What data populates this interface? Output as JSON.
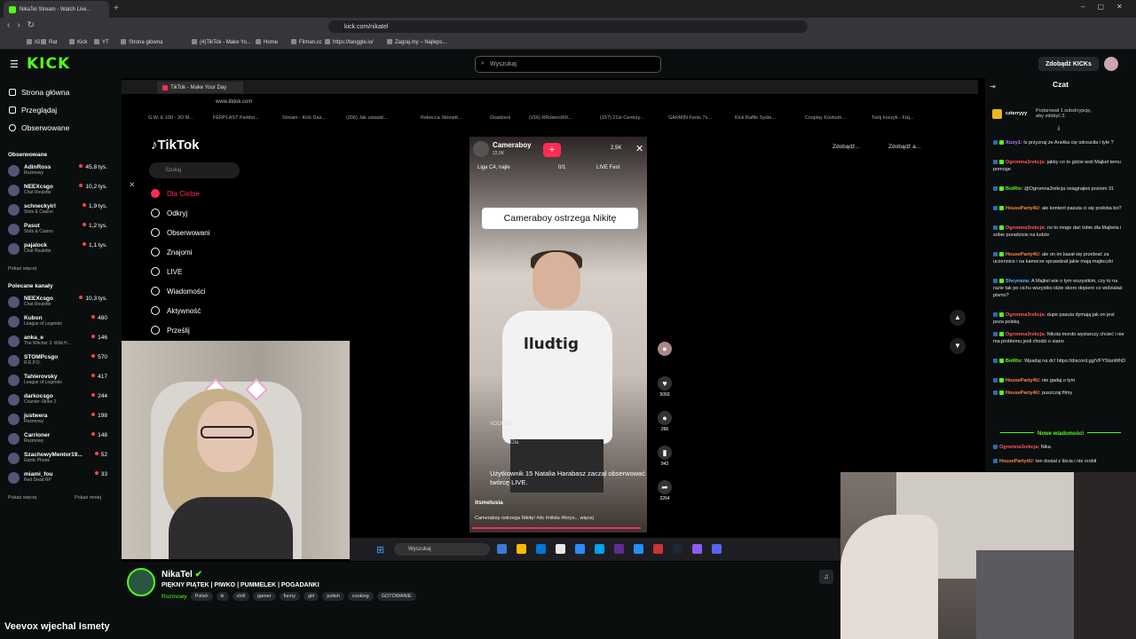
{
  "browser": {
    "tab_title": "NikaTel Stream - Watch Live...",
    "url": "kick.com/nikatel",
    "bookmarks": [
      "IG",
      "Rat",
      "Kick",
      "YT",
      "Strona główna",
      "(4)TikTok - Make Yo...",
      "Home",
      "Filman.cc",
      "https://tanggle.io/",
      "Zagraj.my – Najleps..."
    ]
  },
  "header": {
    "logo": "KICK",
    "search_placeholder": "Wyszukaj",
    "kicks_button": "Zdobądź KICKs"
  },
  "sidebar": {
    "nav": [
      "Strona główna",
      "Przeglądaj",
      "Obserwowane"
    ],
    "followed_title": "Obserwowane",
    "followed": [
      {
        "name": "AdinRoss",
        "category": "Rozmowy",
        "viewers": "45,8 tys."
      },
      {
        "name": "NEEXcsgo",
        "category": "Chat Roulette",
        "viewers": "10,2 tys."
      },
      {
        "name": "schneckyirl",
        "category": "Slots & Casino",
        "viewers": "1,9 tys."
      },
      {
        "name": "Pasut",
        "category": "Slots & Casino",
        "viewers": "1,2 tys."
      },
      {
        "name": "pajalock",
        "category": "Chat Roulette",
        "viewers": "1,1 tys."
      }
    ],
    "show_more": "Pokaż więcej",
    "recommended_title": "Polecane kanały",
    "recommended": [
      {
        "name": "NEEXcsgo",
        "category": "Chat Roulette",
        "viewers": "10,3 tys."
      },
      {
        "name": "Kubon",
        "category": "League of Legends",
        "viewers": "480"
      },
      {
        "name": "anka_e",
        "category": "The Witcher 3: Wild H...",
        "viewers": "146"
      },
      {
        "name": "STOMPcsgo",
        "category": "R.E.P.O.",
        "viewers": "570"
      },
      {
        "name": "Tahlerovsky",
        "category": "League of Legends",
        "viewers": "417"
      },
      {
        "name": "darkocsgo",
        "category": "Counter-Strike 2",
        "viewers": "244"
      },
      {
        "name": "justwera",
        "category": "Rozmowy",
        "viewers": "198"
      },
      {
        "name": "Carrioner",
        "category": "Rozmowy",
        "viewers": "148"
      },
      {
        "name": "SzachowyMentor19...",
        "category": "Gartic Phone",
        "viewers": "52"
      },
      {
        "name": "miami_fou",
        "category": "Red Dead RP",
        "viewers": "33"
      }
    ],
    "show_more2": "Pokaż więcej",
    "show_less": "Pokaż mniej"
  },
  "inner": {
    "tab_title": "TikTok - Make Your Day",
    "url": "www.tiktok.com",
    "bookmarks": [
      "G.W. E 100 - 3D M...",
      "FERPLAST Parkho...",
      "Stream - Kick Das...",
      "(206) Jak ustawić...",
      "Rebecca Stinnett...",
      "Osadzeni",
      "(156) RRoberciKK...",
      "(157) 21st Century...",
      "GARMIN Fenix 7x...",
      "Kick Raffle Syste...",
      "Cosplay Kostium...",
      "Twój koszyk - Fizj..."
    ],
    "tiktok": {
      "logo": "TikTok",
      "search": "Szukaj",
      "nav": [
        "Dla Ciebie",
        "Odkryj",
        "Obserwowani",
        "Znajomi",
        "LIVE",
        "Wiadomości",
        "Aktywność",
        "Prześlij"
      ],
      "header_btns": [
        "Zdobądź...",
        "Zdobądź a..."
      ],
      "live_user": "Cameraboy",
      "live_viewers": "22,0K",
      "live_count": "2,5K",
      "liga": "Liga C4, najle",
      "progress": "0/1",
      "live_fest": "LIVE Fest",
      "bubble": "Cameraboy ostrzega Nikitę",
      "shirt": "lludtig",
      "xd": "XDDDDD",
      "ola": "Ola",
      "joined": "Użytkownik 15 Natalia Harabasz zaczął obserwować twórcę LIVE.",
      "caption_user": "itsmelusia",
      "caption": "Cameraboy ostrzega Nikitę! #dc #nikita #foryo... więcej",
      "rail": [
        "5093",
        "266",
        "943",
        "2264"
      ]
    }
  },
  "taskbar": {
    "search": "Wyszukaj"
  },
  "chat": {
    "title": "Czat",
    "sub_user": "czterryyy",
    "sub_text": "Podarował 1 subskrypcję, aby zdobyć 2.",
    "messages": [
      {
        "user": "Xizzy1:",
        "text": "Is przyznaj że Anetka cię odrzuciła i tyle ?",
        "color": "#b57cff"
      },
      {
        "user": "Ogromna3rekcja:",
        "text": "jakby co to gdzie woli Majkel temu pomoge",
        "color": "#ff5a5a"
      },
      {
        "user": "BotRix:",
        "text": "@Ogromna3rekcja osiągnąłeś poziom 31",
        "color": "#53fc18"
      },
      {
        "user": "HouseParty4U:",
        "text": "ale kontent pasuta ci się podoba bo?",
        "color": "#ff8a3d"
      },
      {
        "user": "Ogromna3rekcja:",
        "text": "no to moge dać tobie dla Majkela i sobie poradzicie na ludzie",
        "color": "#ff5a5a"
      },
      {
        "user": "HouseParty4U:",
        "text": "ale on im kazał się przebrać za uczennice i na kamerze sprawdzał jakie mają majteczki",
        "color": "#ff8a3d"
      },
      {
        "user": "Sheynana:",
        "text": "A Majkel wie o tym wszystkim, czy to na razie tak po cichu wszystko idzie skoro dopiero co widziałaś pismo?",
        "color": "#5ab4ff"
      },
      {
        "user": "Ogromna3rekcja:",
        "text": "dupe pasuta dymają jak on jest poza polską",
        "color": "#ff5a5a"
      },
      {
        "user": "Ogromna3rekcja:",
        "text": "Nikola mordo wystarczy chcieć i nie ma problemu jesli chodzi o siano",
        "color": "#ff5a5a"
      },
      {
        "user": "BotRix:",
        "text": "Wpadaj na dc! https://discord.gg/VFYStsnWhD",
        "color": "#53fc18"
      },
      {
        "user": "HouseParty4U:",
        "text": "nie gadaj o tym",
        "color": "#ff8a3d"
      },
      {
        "user": "HouseParty4U:",
        "text": "puszczaj filmy",
        "color": "#ff8a3d"
      }
    ],
    "new_messages": "Nowe wiadomości",
    "after": [
      {
        "user": "Ogromna3rekcja:",
        "text": "Nika",
        "color": "#ff5a5a"
      },
      {
        "user": "HouseParty4U:",
        "text": "ten dostał z liścia i nie zrobił",
        "color": "#ff8a3d"
      }
    ]
  },
  "info": {
    "streamer": "NikaTel",
    "title": "PIĘKNY PIĄTEK | PIWKO | PUMMELEK | POGADANKI",
    "category": "Rozmowy",
    "tags": [
      "Polish",
      "ki",
      "chill",
      "gamer",
      "funny",
      "girl",
      "polish",
      "cooking",
      "GOTOWANIE"
    ]
  },
  "overlay_text": "Veevox wjechal Ismety"
}
